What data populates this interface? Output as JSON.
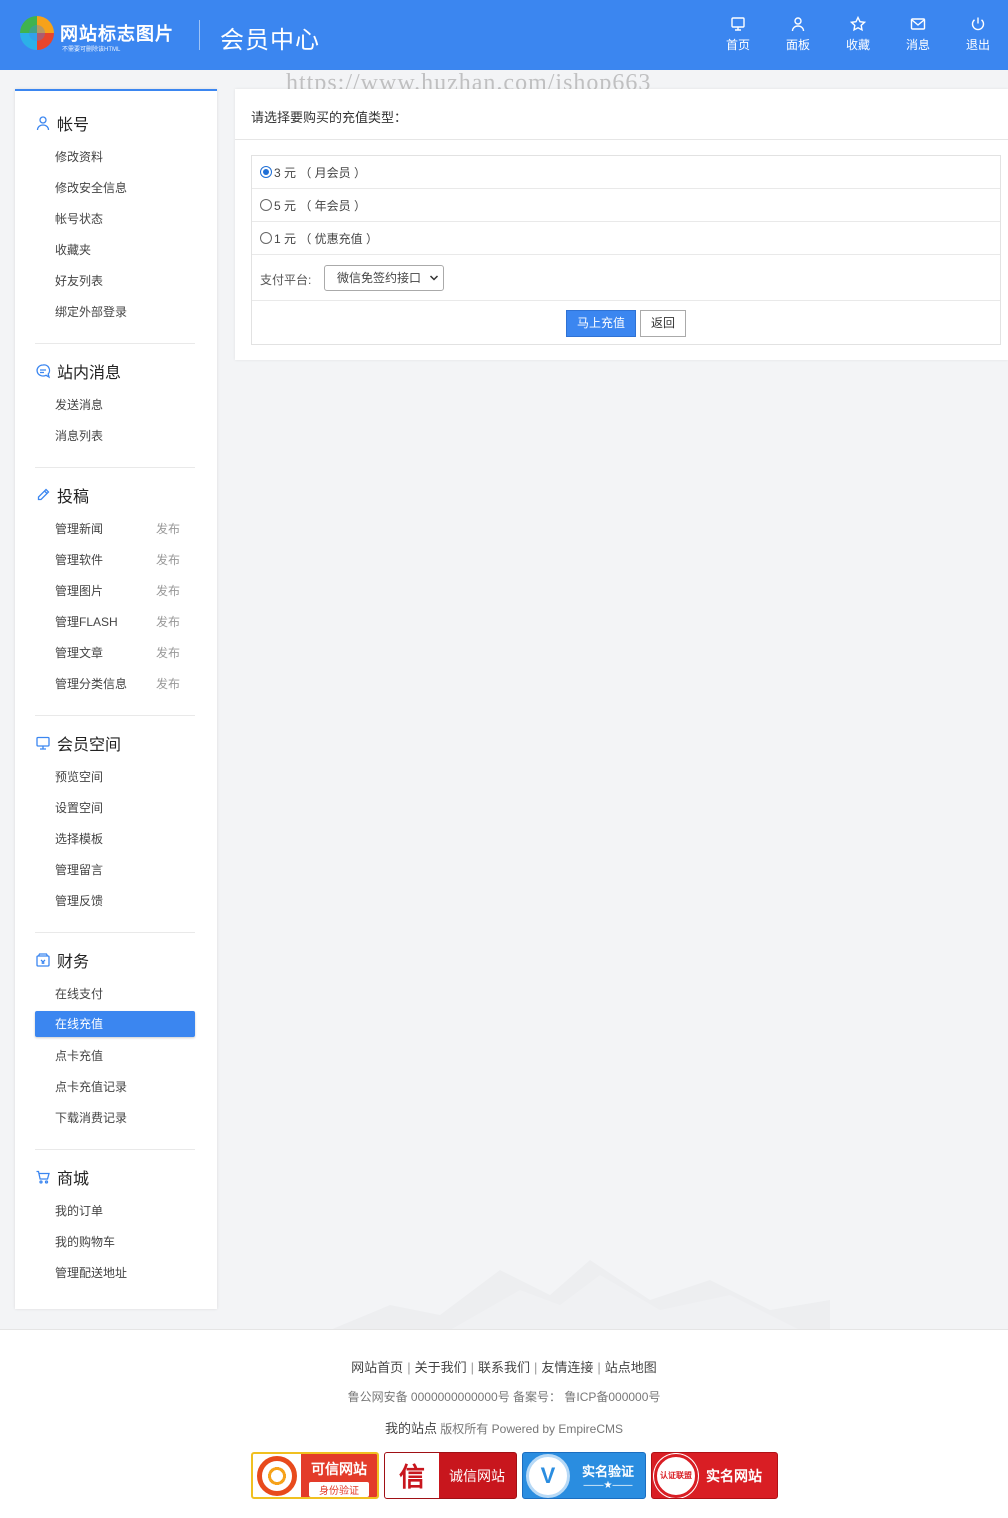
{
  "header": {
    "site_name": "网站标志图片",
    "site_sub": "不需要可删除该HTML",
    "center_title": "会员中心",
    "nav": [
      {
        "label": "首页",
        "icon": "monitor-icon"
      },
      {
        "label": "面板",
        "icon": "user-icon"
      },
      {
        "label": "收藏",
        "icon": "star-icon"
      },
      {
        "label": "消息",
        "icon": "mail-icon"
      },
      {
        "label": "退出",
        "icon": "power-icon"
      }
    ]
  },
  "watermark": "https://www.huzhan.com/ishop663",
  "sidebar": {
    "groups": [
      {
        "title": "帐号",
        "icon": "user-icon",
        "items": [
          "修改资料",
          "修改安全信息",
          "帐号状态",
          "收藏夹",
          "好友列表",
          "绑定外部登录"
        ]
      },
      {
        "title": "站内消息",
        "icon": "message-icon",
        "items": [
          "发送消息",
          "消息列表"
        ]
      },
      {
        "title": "投稿",
        "icon": "pen-icon",
        "items": [
          "管理新闻",
          "管理软件",
          "管理图片",
          "管理FLASH",
          "管理文章",
          "管理分类信息"
        ],
        "publish_label": "发布"
      },
      {
        "title": "会员空间",
        "icon": "monitor-icon",
        "items": [
          "预览空间",
          "设置空间",
          "选择模板",
          "管理留言",
          "管理反馈"
        ]
      },
      {
        "title": "财务",
        "icon": "wallet-icon",
        "items": [
          "在线支付",
          "在线充值",
          "点卡充值",
          "点卡充值记录",
          "下载消费记录"
        ],
        "active_index": 1
      },
      {
        "title": "商城",
        "icon": "cart-icon",
        "items": [
          "我的订单",
          "我的购物车",
          "管理配送地址"
        ]
      }
    ]
  },
  "main": {
    "heading": "请选择要购买的充值类型：",
    "options": [
      {
        "text": "3 元 （ 月会员 ）",
        "checked": true
      },
      {
        "text": "5 元 （ 年会员 ）",
        "checked": false
      },
      {
        "text": "1 元 （ 优惠充值 ）",
        "checked": false
      }
    ],
    "pay_label": "支付平台:",
    "pay_selected": "微信免签约接口",
    "submit_label": "马上充值",
    "back_label": "返回"
  },
  "footer": {
    "links": [
      "网站首页",
      "关于我们",
      "联系我们",
      "友情连接",
      "站点地图"
    ],
    "beian": "鲁公网安备 0000000000000号 备案号：  鲁ICP备000000号",
    "site": "我的站点",
    "copyright": " 版权所有 Powered by EmpireCMS",
    "badges": {
      "b1_t1": "可信网站",
      "b1_t2": "身份验证",
      "b2_l": "信",
      "b2_r": "诚信网站",
      "b3_t1": "实名验证",
      "b3_t2": "——★——",
      "b4_seal": "认证联盟",
      "b4_r": "实名网站"
    }
  },
  "colors": {
    "primary": "#3b86f0",
    "bg": "#f3f4f6"
  }
}
